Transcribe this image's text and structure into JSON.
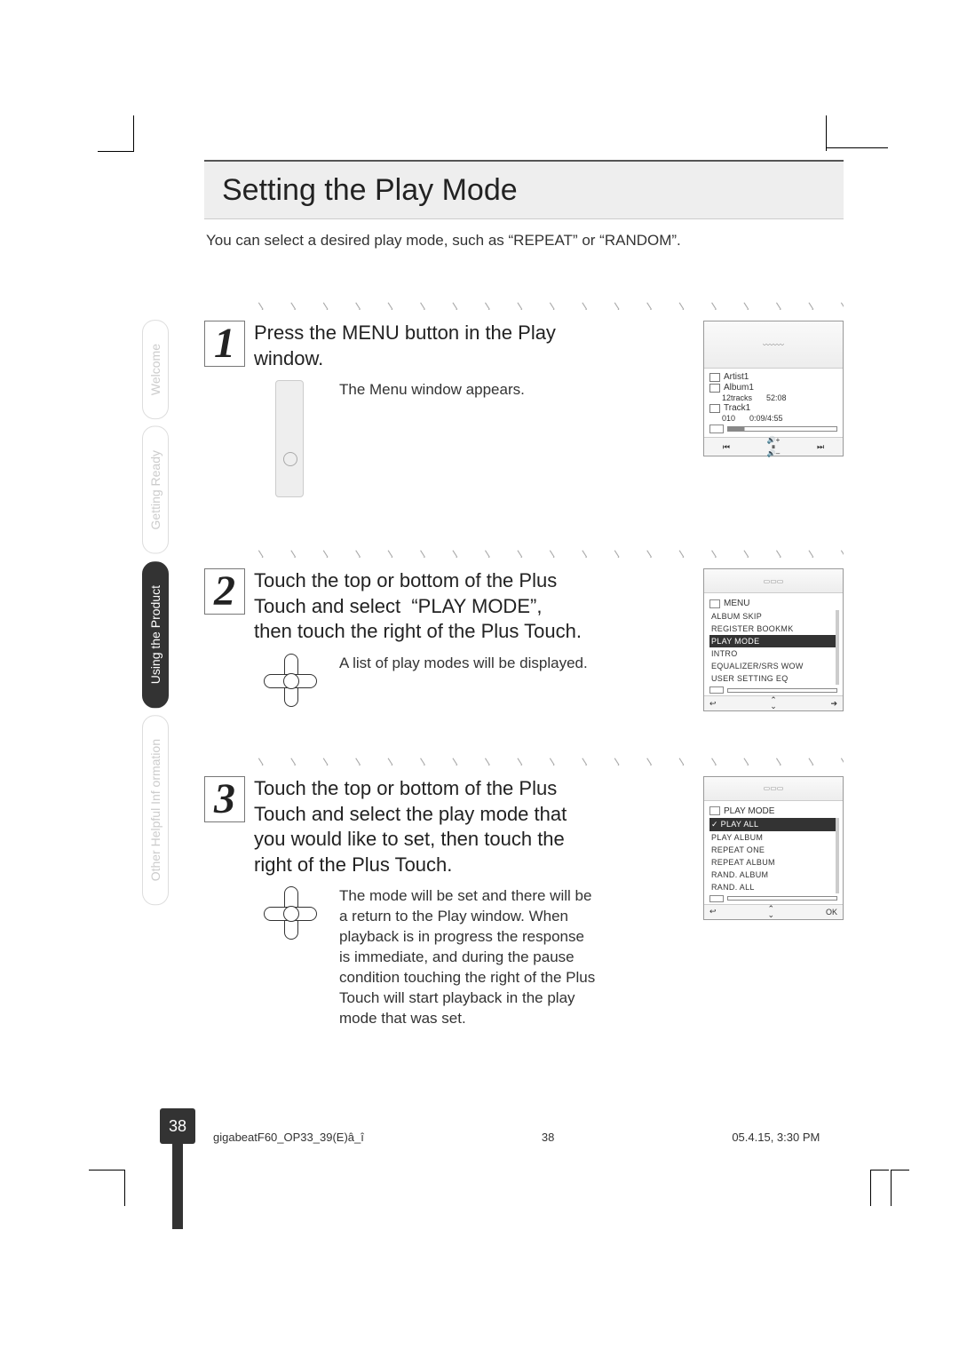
{
  "page": {
    "title": "Setting the Play Mode",
    "intro": "You can select a desired play mode, such as “REPEAT” or “RANDOM”.",
    "number": "38"
  },
  "tabs": {
    "welcome": "Welcome",
    "getting_ready": "Getting Ready",
    "using_product": "Using the Product",
    "other_help": "Other Helpful Inf ormation"
  },
  "steps": [
    {
      "num": "1",
      "heading": "Press the MENU button in the Play window.",
      "detail": "The Menu window appears."
    },
    {
      "num": "2",
      "heading": "Touch the top or bottom of the Plus Touch and select  “PLAY MODE”, then touch the right of the Plus Touch.",
      "detail": "A list of play modes will be displayed."
    },
    {
      "num": "3",
      "heading": "Touch the top or bottom of the Plus Touch and select the play mode that you would like to set, then touch the right of the Plus Touch.",
      "detail": "The mode will be set and there will be a return to the Play window. When playback is in progress the response is immediate, and during the pause condition touching the right of the Plus Touch will start playback in the play mode that was set."
    }
  ],
  "screen1": {
    "artist": "Artist1",
    "album": "Album1",
    "tracks": "12tracks",
    "total": "52:08",
    "track": "Track1",
    "trackno": "010",
    "time": "0:09/4:55",
    "vol_plus": "+",
    "vol_minus": "–",
    "prev": "⏮",
    "pause": "⏸",
    "next": "⏭"
  },
  "screen2": {
    "title": "MENU",
    "items": [
      "ALBUM SKIP",
      "REGISTER BOOKMK",
      "PLAY MODE",
      "INTRO",
      "EQUALIZER/SRS WOW",
      "USER SETTING EQ"
    ],
    "sel_index": 2,
    "right": "➔"
  },
  "screen3": {
    "title": "PLAY MODE",
    "items": [
      "PLAY ALL",
      "PLAY ALBUM",
      "REPEAT ONE",
      "REPEAT ALBUM",
      "RAND. ALBUM",
      "RAND. ALL"
    ],
    "sel_index": 0,
    "ok": "OK"
  },
  "footer": {
    "file": "gigabeatF60_OP33_39(E)â_î",
    "pg": "38",
    "date": "05.4.15, 3:30 PM"
  },
  "dots": "〉 〉 〉 〉 〉 〉 〉 〉 〉 〉 〉 〉 〉 〉 〉 〉 〉 〉 〉 〉 〉 〉 〉 〉 〉 〉 〉 〉 〉 〉 〉 〉 〉 〉 〉 〉 〉 〉 〉 〉 〉 〉 〉"
}
